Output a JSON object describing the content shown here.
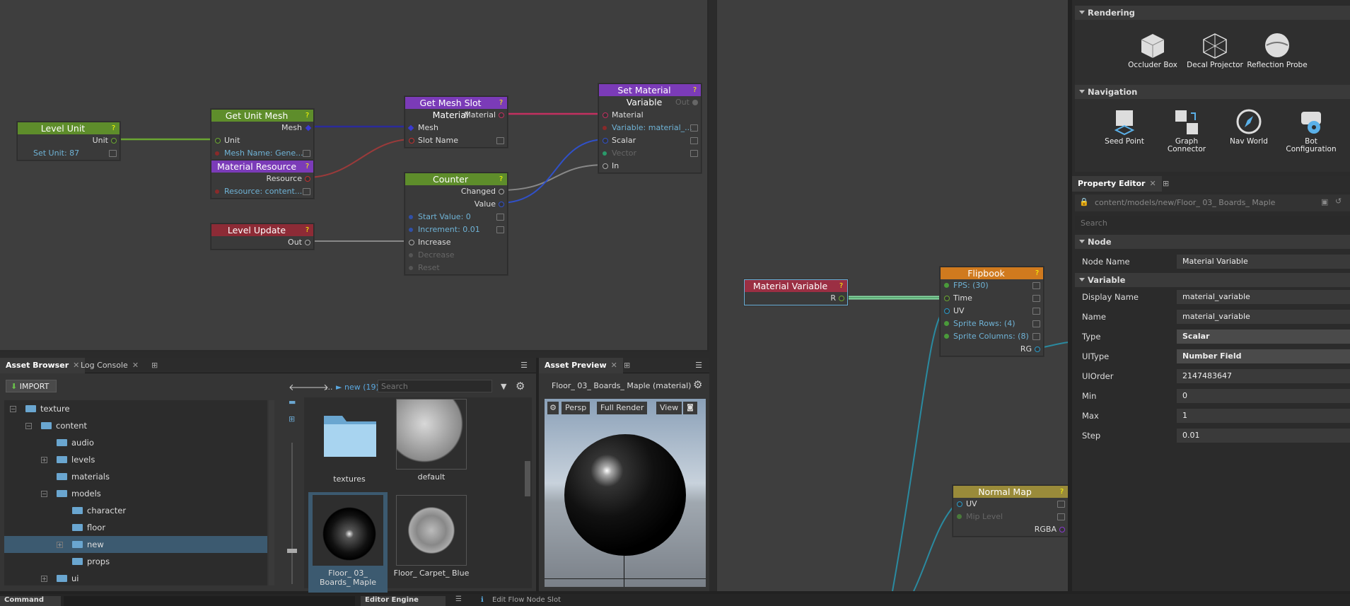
{
  "flow1": {
    "level_unit": {
      "title": "Level Unit",
      "out": "Unit",
      "prop": "Set Unit: 87"
    },
    "get_unit_mesh": {
      "title": "Get Unit Mesh",
      "out": "Mesh",
      "in": "Unit",
      "prop": "Mesh Name: Gene..."
    },
    "material_resource": {
      "title": "Material Resource",
      "out": "Resource",
      "prop": "Resource: content..."
    },
    "level_update": {
      "title": "Level Update",
      "out": "Out"
    },
    "get_mesh_slot": {
      "title": "Get Mesh Slot Material",
      "out": "Material",
      "in1": "Mesh",
      "in2": "Slot Name"
    },
    "counter": {
      "title": "Counter",
      "out1": "Changed",
      "out2": "Value",
      "p1": "Start Value: 0",
      "p2": "Increment: 0.01",
      "in1": "Increase",
      "in2": "Decrease",
      "in3": "Reset"
    },
    "set_material_var": {
      "title": "Set Material Variable",
      "out": "Out",
      "in1": "Material",
      "p1": "Variable: material_...",
      "in2": "Scalar",
      "in3": "Vector",
      "in4": "In"
    }
  },
  "flow2": {
    "material_variable": {
      "title": "Material Variable",
      "out": "R"
    },
    "flipbook": {
      "title": "Flipbook",
      "p1": "FPS: (30)",
      "in1": "Time",
      "in2": "UV",
      "p2": "Sprite Rows: (4)",
      "p3": "Sprite Columns: (8)",
      "out": "RG"
    },
    "normal_map": {
      "title": "Normal Map",
      "in1": "UV",
      "p1": "Mip Level",
      "out": "RGBA"
    }
  },
  "asset_browser": {
    "tabs": [
      "Asset Browser",
      "Log Console"
    ],
    "import": "IMPORT",
    "path_prefix": "...",
    "path": "new (19)",
    "search_placeholder": "Search",
    "tree": [
      {
        "label": "texture",
        "depth": 0,
        "exp": "-"
      },
      {
        "label": "content",
        "depth": 1,
        "exp": "-"
      },
      {
        "label": "audio",
        "depth": 2,
        "exp": ""
      },
      {
        "label": "levels",
        "depth": 2,
        "exp": "+"
      },
      {
        "label": "materials",
        "depth": 2,
        "exp": ""
      },
      {
        "label": "models",
        "depth": 2,
        "exp": "-"
      },
      {
        "label": "character",
        "depth": 3,
        "exp": ""
      },
      {
        "label": "floor",
        "depth": 3,
        "exp": ""
      },
      {
        "label": "new",
        "depth": 3,
        "exp": "+",
        "sel": true
      },
      {
        "label": "props",
        "depth": 3,
        "exp": ""
      },
      {
        "label": "ui",
        "depth": 2,
        "exp": "+"
      }
    ],
    "items": [
      "textures",
      "default",
      "Floor_ 03_ Boards_ Maple",
      "Floor_ Carpet_ Blue"
    ]
  },
  "asset_preview": {
    "tab": "Asset Preview",
    "name": "Floor_ 03_ Boards_ Maple (material)",
    "buttons": [
      "Persp",
      "Full Render",
      "View"
    ]
  },
  "right": {
    "rendering": "Rendering",
    "rendering_items": [
      "Occluder Box",
      "Decal Projector",
      "Reflection Probe"
    ],
    "navigation": "Navigation",
    "navigation_items": [
      "Seed Point",
      "Graph Connector",
      "Nav World",
      "Bot Configuration"
    ],
    "prop_tab": "Property Editor",
    "path": "content/models/new/Floor_ 03_ Boards_ Maple",
    "search_placeholder": "Search",
    "node_section": "Node",
    "node_name_label": "Node Name",
    "node_name": "Material Variable",
    "variable_section": "Variable",
    "rows": [
      {
        "label": "Display Name",
        "value": "material_variable"
      },
      {
        "label": "Name",
        "value": "material_variable"
      },
      {
        "label": "Type",
        "value": "Scalar"
      },
      {
        "label": "UIType",
        "value": "Number Field"
      },
      {
        "label": "UIOrder",
        "value": "2147483647"
      },
      {
        "label": "Min",
        "value": "0"
      },
      {
        "label": "Max",
        "value": "1"
      },
      {
        "label": "Step",
        "value": "0.01"
      }
    ]
  },
  "status": {
    "command": "Command",
    "editor_engine": "Editor Engine",
    "message": "Edit Flow Node Slot"
  }
}
